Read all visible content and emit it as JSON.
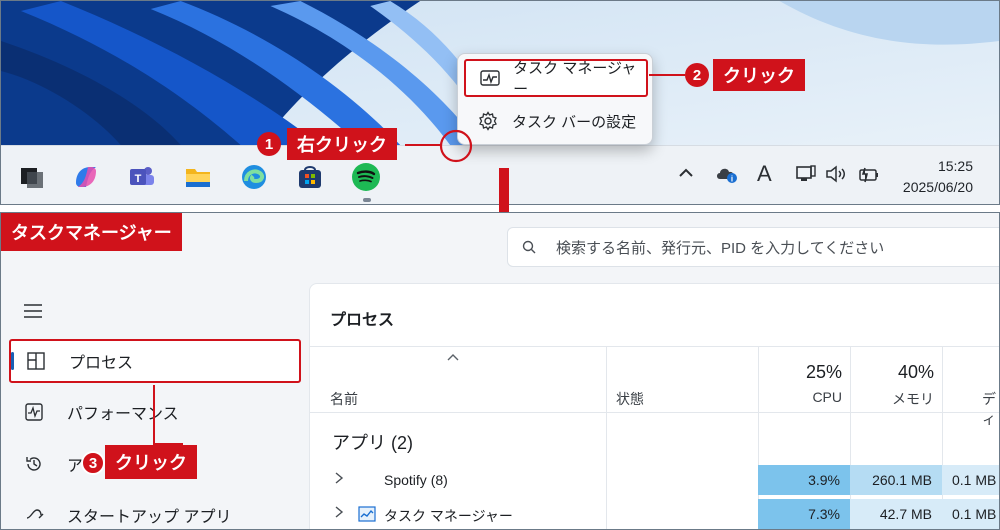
{
  "colors": {
    "accent": "#d0121b",
    "cpu_cell": "#7cc3ec",
    "mem_cell": "#b5dcf3",
    "disk_cell": "#d7ebf8"
  },
  "taskbar": {
    "icons": [
      "windows-icon",
      "copilot-icon",
      "teams-icon",
      "file-explorer-icon",
      "edge-icon",
      "store-icon",
      "spotify-icon"
    ],
    "tray_icons": [
      "chevron-up-icon",
      "cloud-sync-icon",
      "ime-a-icon",
      "network-icon",
      "volume-icon",
      "battery-icon"
    ],
    "ime_label": "A",
    "clock_time": "15:25",
    "clock_date": "2025/06/20"
  },
  "context_menu": {
    "items": [
      {
        "label": "タスク マネージャー",
        "icon": "activity-icon"
      },
      {
        "label": "タスク バーの設定",
        "icon": "gear-icon"
      }
    ]
  },
  "callouts": {
    "step1_num": "1",
    "step1_label": "右クリック",
    "step2_num": "2",
    "step2_label": "クリック",
    "step3_num": "3",
    "step3_label": "クリック"
  },
  "task_manager": {
    "title": "タスクマネージャー",
    "search_placeholder": "検索する名前、発行元、PID を入力してください",
    "nav": [
      {
        "label": "プロセス",
        "icon": "processes-icon"
      },
      {
        "label": "パフォーマンス",
        "icon": "performance-icon"
      },
      {
        "label": "ア",
        "icon": "history-icon"
      },
      {
        "label": "スタートアップ アプリ",
        "icon": "startup-icon"
      }
    ],
    "section_title": "プロセス",
    "columns": {
      "name": "名前",
      "status": "状態",
      "cpu": "CPU",
      "memory": "メモリ",
      "disk": "ディ"
    },
    "cpu_percent": "25%",
    "memory_percent": "40%",
    "group_label": "アプリ (2)",
    "rows": [
      {
        "name": "Spotify (8)",
        "cpu": "3.9%",
        "memory": "260.1 MB",
        "disk": "0.1 MB"
      },
      {
        "name": "タスク マネージャー",
        "cpu": "7.3%",
        "memory": "42.7 MB",
        "disk": "0.1 MB"
      }
    ]
  }
}
